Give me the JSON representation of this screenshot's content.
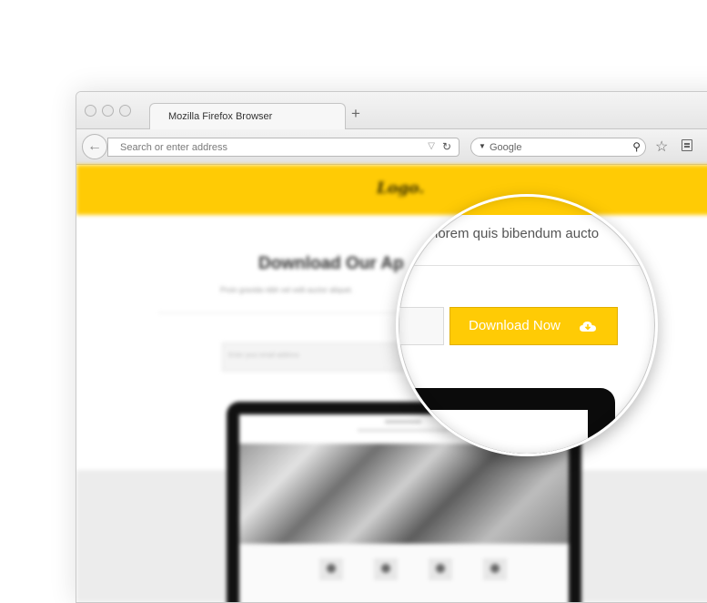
{
  "browser": {
    "tab_title": "Mozilla Firefox Browser",
    "new_tab": "+",
    "url_placeholder": "Search or enter address",
    "search_engine": "Google"
  },
  "page": {
    "logo": "Logo.",
    "headline": "Download Our Ap",
    "subtext": "Proin gravida nibh vel velit auctor aliquet.",
    "email_placeholder": "Enter your email address",
    "accent_color": "#ffcb05"
  },
  "magnifier": {
    "subtext": "lorem quis bibendum aucto",
    "download_label": "Download Now"
  }
}
